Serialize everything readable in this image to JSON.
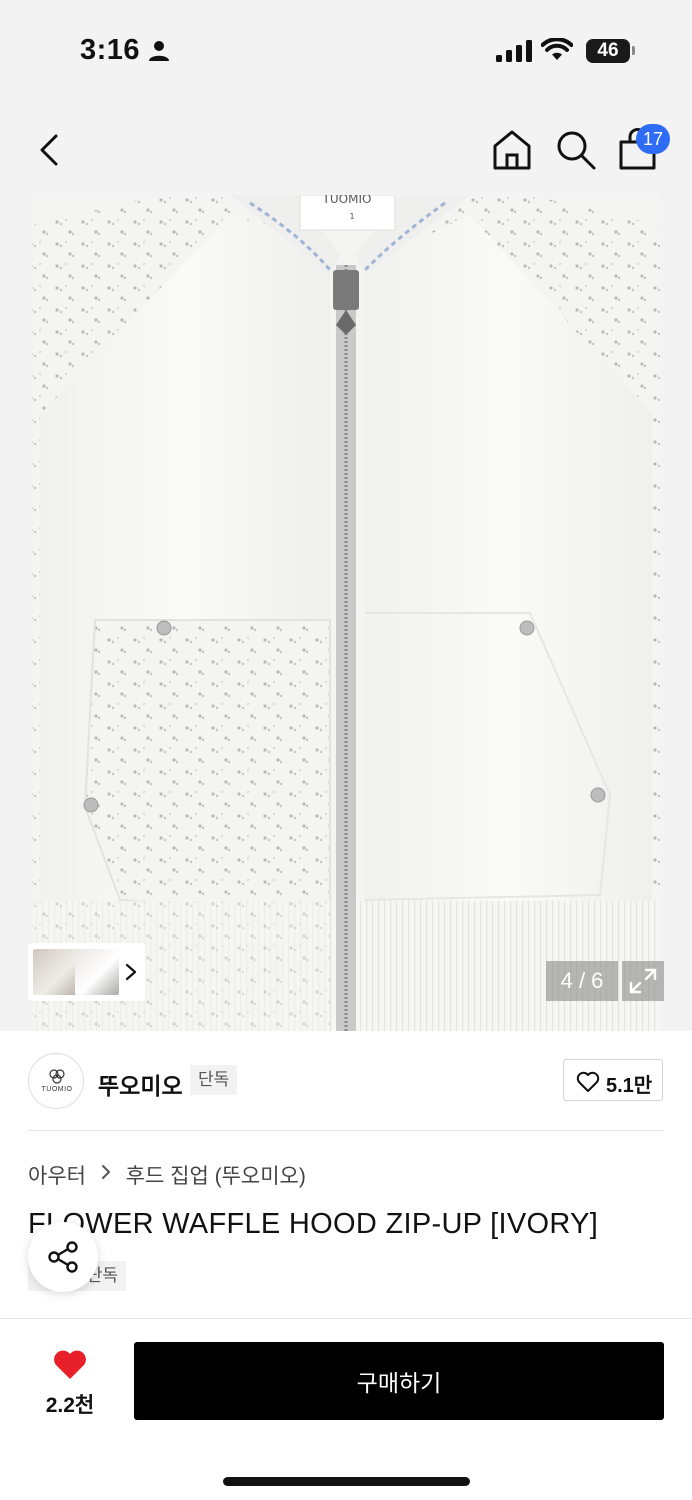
{
  "status_bar": {
    "time": "3:16",
    "battery": "46"
  },
  "header": {
    "cart_count": "17",
    "icons": [
      "back-icon",
      "home-icon",
      "search-icon",
      "shopping-bag-icon"
    ]
  },
  "gallery": {
    "counter": "4 / 6",
    "garment_label": "TUOMIO",
    "garment_size": "1"
  },
  "brand": {
    "logo_text": "TUOMIO",
    "name": "뚜오미오",
    "tag": "단독",
    "likes": "5.1만"
  },
  "product": {
    "breadcrumb": [
      "아우터",
      "후드 집업 (뚜오미오)"
    ],
    "title": "FLOWER WAFFLE HOOD ZIP-UP [IVORY]",
    "tag": "단독"
  },
  "bottom_bar": {
    "wish_count": "2.2천",
    "buy_label": "구매하기"
  },
  "colors": {
    "accent_badge": "#2f6cf6",
    "heart": "#e8202a",
    "buy_button": "#000000"
  }
}
